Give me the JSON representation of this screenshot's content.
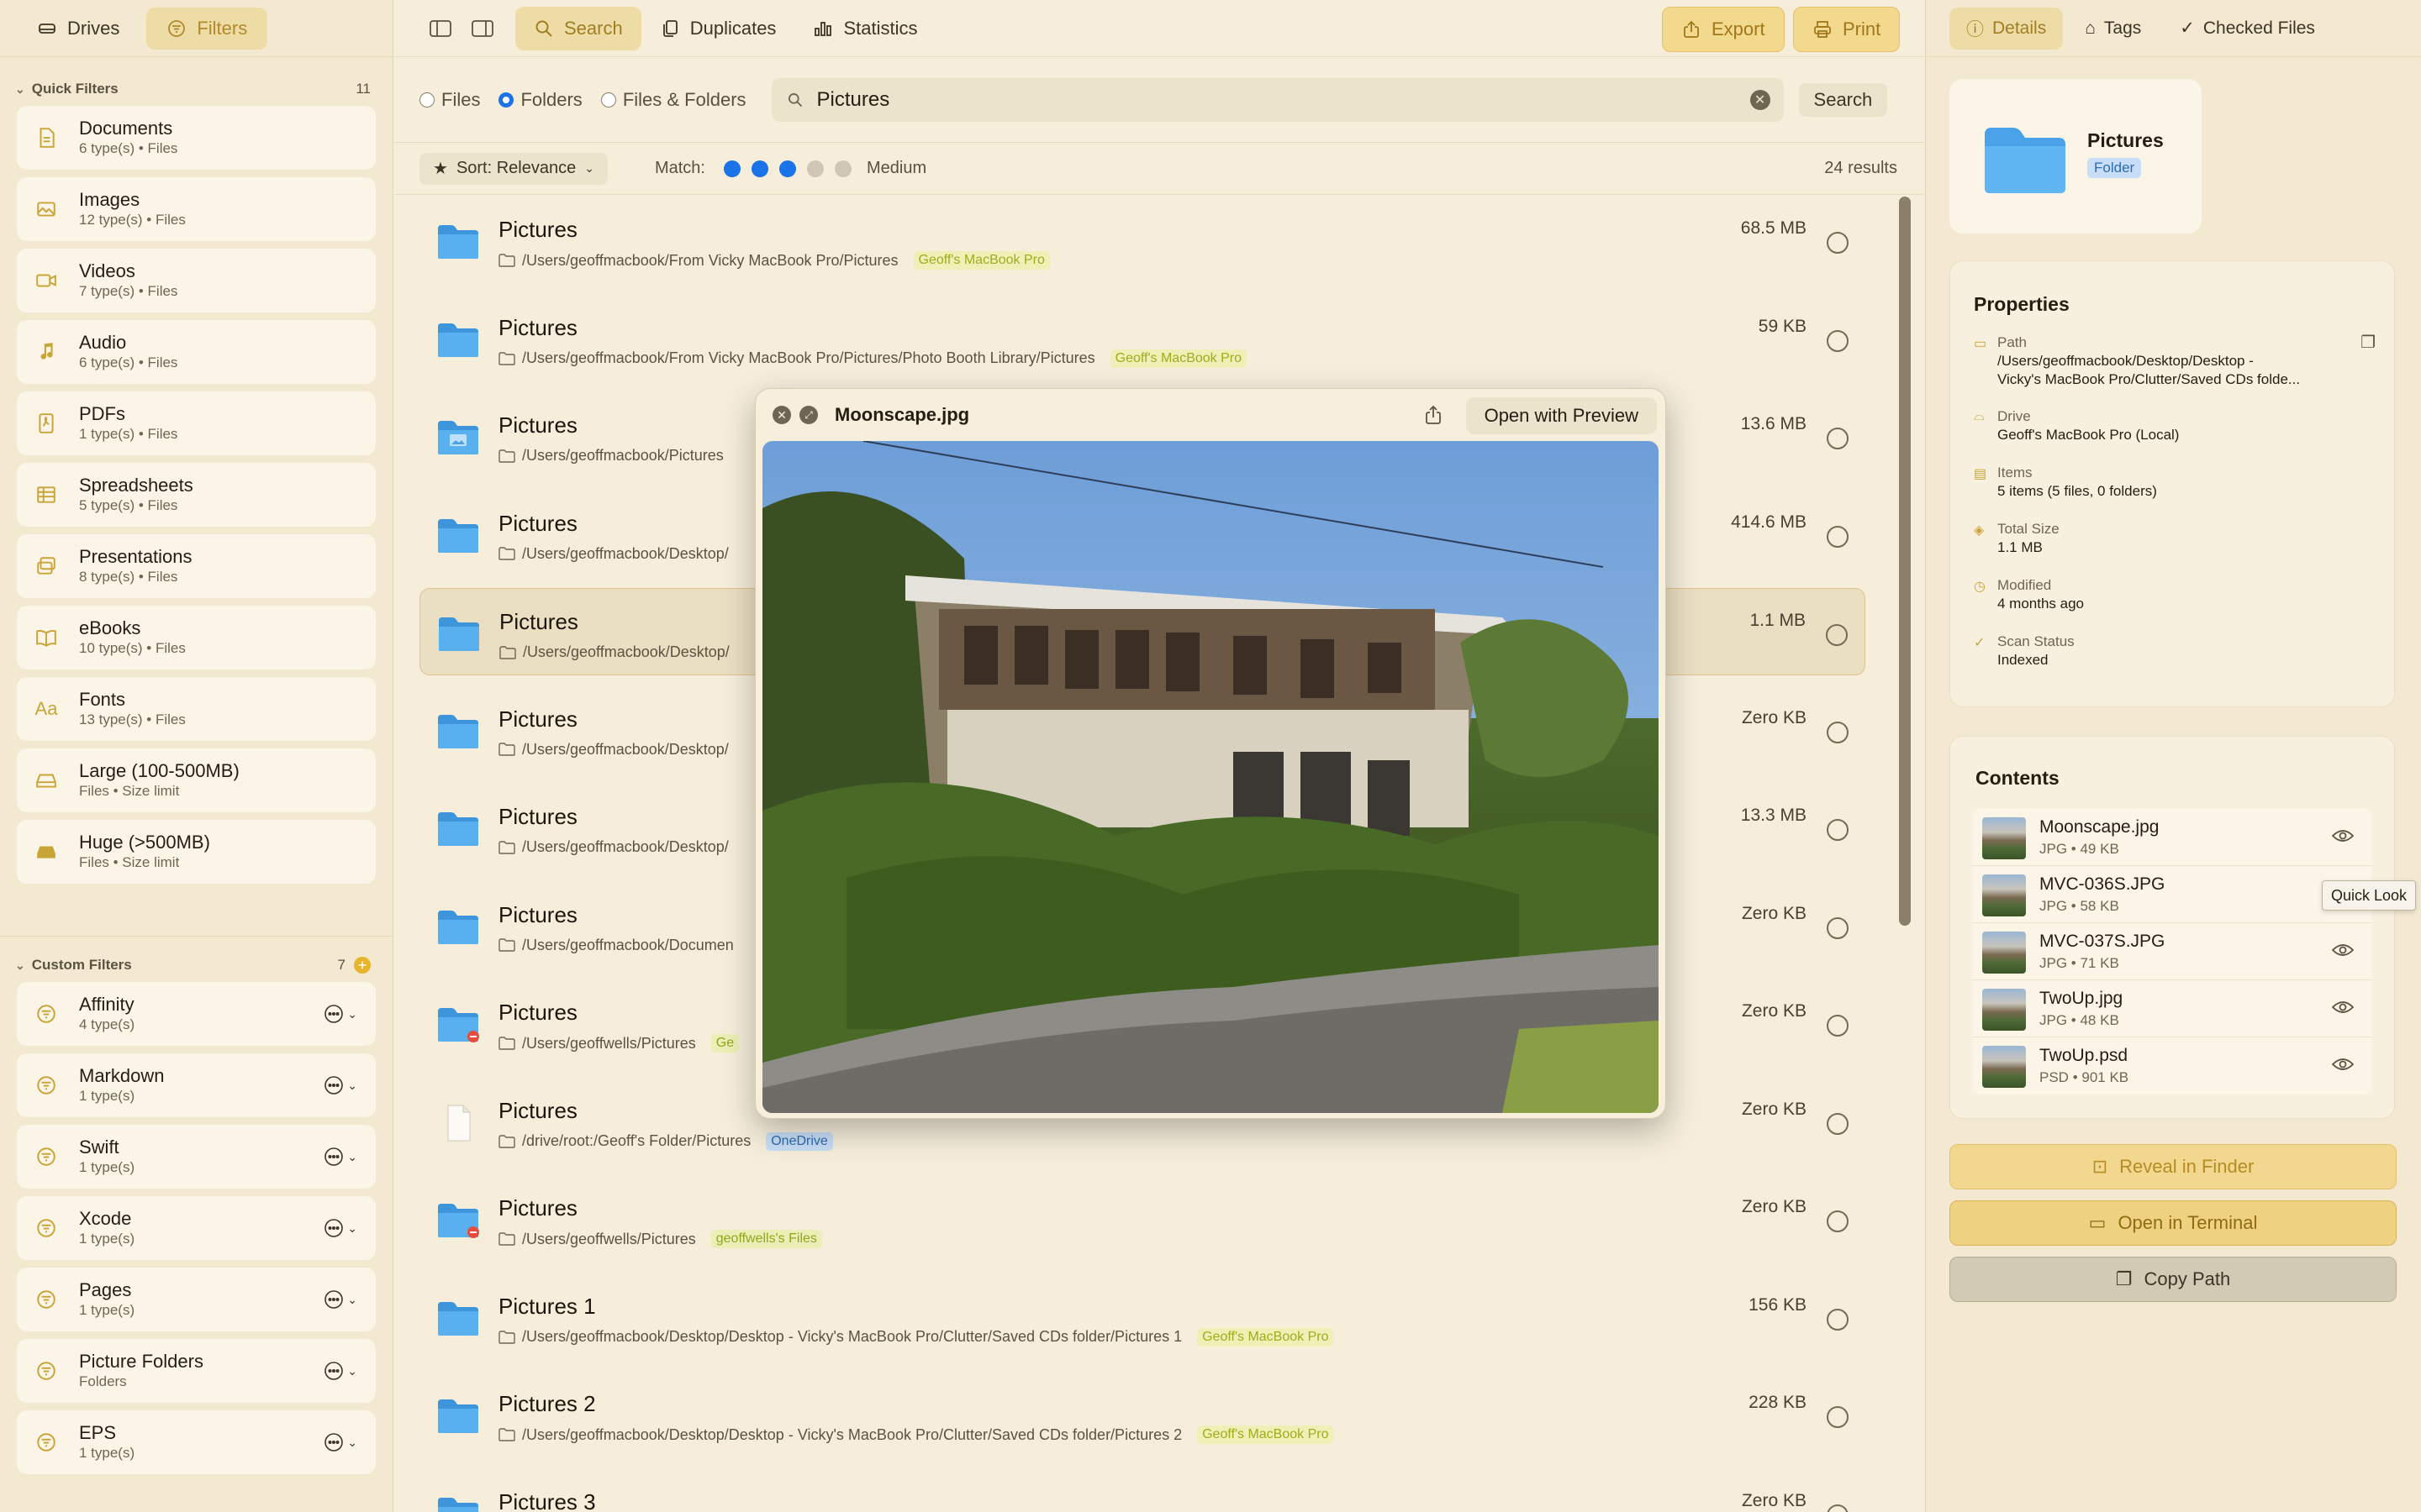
{
  "sidebar": {
    "tabs": [
      {
        "label": "Drives"
      },
      {
        "label": "Filters"
      }
    ],
    "quick_filters": {
      "title": "Quick Filters",
      "count": "11",
      "items": [
        {
          "title": "Documents",
          "sub": "6 type(s) • Files",
          "icon": "document-icon"
        },
        {
          "title": "Images",
          "sub": "12 type(s) • Files",
          "icon": "photo-icon"
        },
        {
          "title": "Videos",
          "sub": "7 type(s) • Files",
          "icon": "video-icon"
        },
        {
          "title": "Audio",
          "sub": "6 type(s) • Files",
          "icon": "music-note-icon"
        },
        {
          "title": "PDFs",
          "sub": "1 type(s) • Files",
          "icon": "pdf-icon"
        },
        {
          "title": "Spreadsheets",
          "sub": "5 type(s) • Files",
          "icon": "table-icon"
        },
        {
          "title": "Presentations",
          "sub": "8 type(s) • Files",
          "icon": "slides-icon"
        },
        {
          "title": "eBooks",
          "sub": "10 type(s) • Files",
          "icon": "book-icon"
        },
        {
          "title": "Fonts",
          "sub": "13 type(s) • Files",
          "icon": "font-icon"
        },
        {
          "title": "Large (100-500MB)",
          "sub": "Files • Size limit",
          "icon": "drive-icon"
        },
        {
          "title": "Huge (>500MB)",
          "sub": "Files • Size limit",
          "icon": "drive-filled-icon"
        }
      ]
    },
    "custom_filters": {
      "title": "Custom Filters",
      "count": "7",
      "items": [
        {
          "title": "Affinity",
          "sub": "4 type(s)"
        },
        {
          "title": "Markdown",
          "sub": "1 type(s)"
        },
        {
          "title": "Swift",
          "sub": "1 type(s)"
        },
        {
          "title": "Xcode",
          "sub": "1 type(s)"
        },
        {
          "title": "Pages",
          "sub": "1 type(s)"
        },
        {
          "title": "Picture  Folders",
          "sub": "Folders"
        },
        {
          "title": "EPS",
          "sub": "1 type(s)"
        }
      ]
    }
  },
  "toolbar": {
    "tabs": [
      {
        "label": "Search"
      },
      {
        "label": "Duplicates"
      },
      {
        "label": "Statistics"
      }
    ],
    "export_label": "Export",
    "print_label": "Print"
  },
  "search": {
    "scope_options": [
      "Files",
      "Folders",
      "Files & Folders"
    ],
    "selected_scope": "Folders",
    "query": "Pictures",
    "button_label": "Search"
  },
  "filter_bar": {
    "sort_label": "Sort: Relevance",
    "match_label": "Match:",
    "match_level": 3,
    "match_total": 5,
    "match_text": "Medium",
    "results_count": "24 results"
  },
  "results": [
    {
      "name": "Pictures",
      "path": "/Users/geoffmacbook/From Vicky MacBook Pro/Pictures",
      "badge": "Geoff's MacBook Pro",
      "badge_type": "mac",
      "size": "68.5 MB",
      "kind": "folder"
    },
    {
      "name": "Pictures",
      "path": "/Users/geoffmacbook/From Vicky MacBook Pro/Pictures/Photo Booth Library/Pictures",
      "badge": "Geoff's MacBook Pro",
      "badge_type": "mac",
      "size": "59 KB",
      "kind": "folder"
    },
    {
      "name": "Pictures",
      "path": "/Users/geoffmacbook/Pictures",
      "badge": "",
      "badge_type": "",
      "size": "13.6 MB",
      "kind": "pictures-folder"
    },
    {
      "name": "Pictures",
      "path": "/Users/geoffmacbook/Desktop/",
      "badge": "",
      "badge_type": "",
      "size": "414.6 MB",
      "kind": "folder"
    },
    {
      "name": "Pictures",
      "path": "/Users/geoffmacbook/Desktop/",
      "badge": "",
      "badge_type": "",
      "size": "1.1 MB",
      "kind": "folder",
      "selected": true
    },
    {
      "name": "Pictures",
      "path": "/Users/geoffmacbook/Desktop/",
      "badge": "",
      "badge_type": "",
      "size": "Zero KB",
      "kind": "folder"
    },
    {
      "name": "Pictures",
      "path": "/Users/geoffmacbook/Desktop/",
      "badge": "",
      "badge_type": "",
      "size": "13.3 MB",
      "kind": "folder"
    },
    {
      "name": "Pictures",
      "path": "/Users/geoffmacbook/Documen",
      "badge": "",
      "badge_type": "",
      "size": "Zero KB",
      "kind": "folder"
    },
    {
      "name": "Pictures",
      "path": "/Users/geoffwells/Pictures",
      "badge": "Ge",
      "badge_type": "gw",
      "size": "Zero KB",
      "kind": "restricted-folder"
    },
    {
      "name": "Pictures",
      "path": "/drive/root:/Geoff's Folder/Pictures",
      "badge": "OneDrive",
      "badge_type": "od",
      "size": "Zero KB",
      "kind": "file"
    },
    {
      "name": "Pictures",
      "path": "/Users/geoffwells/Pictures",
      "badge": "geoffwells's Files",
      "badge_type": "gw",
      "size": "Zero KB",
      "kind": "restricted-folder"
    },
    {
      "name": "Pictures 1",
      "path": "/Users/geoffmacbook/Desktop/Desktop - Vicky's MacBook Pro/Clutter/Saved CDs folder/Pictures 1",
      "badge": "Geoff's MacBook Pro",
      "badge_type": "mac",
      "size": "156 KB",
      "kind": "folder"
    },
    {
      "name": "Pictures 2",
      "path": "/Users/geoffmacbook/Desktop/Desktop - Vicky's MacBook Pro/Clutter/Saved CDs folder/Pictures 2",
      "badge": "Geoff's MacBook Pro",
      "badge_type": "mac",
      "size": "228 KB",
      "kind": "folder"
    },
    {
      "name": "Pictures 3",
      "path": "",
      "badge": "",
      "badge_type": "",
      "size": "Zero KB",
      "kind": "folder"
    }
  ],
  "quick_look": {
    "title": "Moonscape.jpg",
    "open_label": "Open with Preview"
  },
  "right_panel": {
    "tabs": [
      {
        "label": "Details"
      },
      {
        "label": "Tags"
      },
      {
        "label": "Checked Files"
      }
    ],
    "hero": {
      "name": "Pictures",
      "kind": "Folder"
    },
    "properties": {
      "title": "Properties",
      "path_label": "Path",
      "path_value_1": "/Users/geoffmacbook/Desktop/Desktop -",
      "path_value_2": "Vicky's MacBook Pro/Clutter/Saved CDs folde...",
      "drive_label": "Drive",
      "drive_value": "Geoff's MacBook Pro (Local)",
      "items_label": "Items",
      "items_value": "5 items (5 files, 0 folders)",
      "size_label": "Total Size",
      "size_value": "1.1 MB",
      "modified_label": "Modified",
      "modified_value": "4 months ago",
      "scan_label": "Scan Status",
      "scan_value": "Indexed"
    },
    "contents": {
      "title": "Contents",
      "items": [
        {
          "name": "Moonscape.jpg",
          "type": "JPG",
          "size": "49 KB"
        },
        {
          "name": "MVC-036S.JPG",
          "type": "JPG",
          "size": "58 KB"
        },
        {
          "name": "MVC-037S.JPG",
          "type": "JPG",
          "size": "71 KB"
        },
        {
          "name": "TwoUp.jpg",
          "type": "JPG",
          "size": "48 KB"
        },
        {
          "name": "TwoUp.psd",
          "type": "PSD",
          "size": "901 KB"
        }
      ]
    },
    "tooltip": "Quick Look",
    "actions": {
      "reveal": "Reveal in Finder",
      "terminal": "Open in Terminal",
      "copy": "Copy Path"
    }
  }
}
